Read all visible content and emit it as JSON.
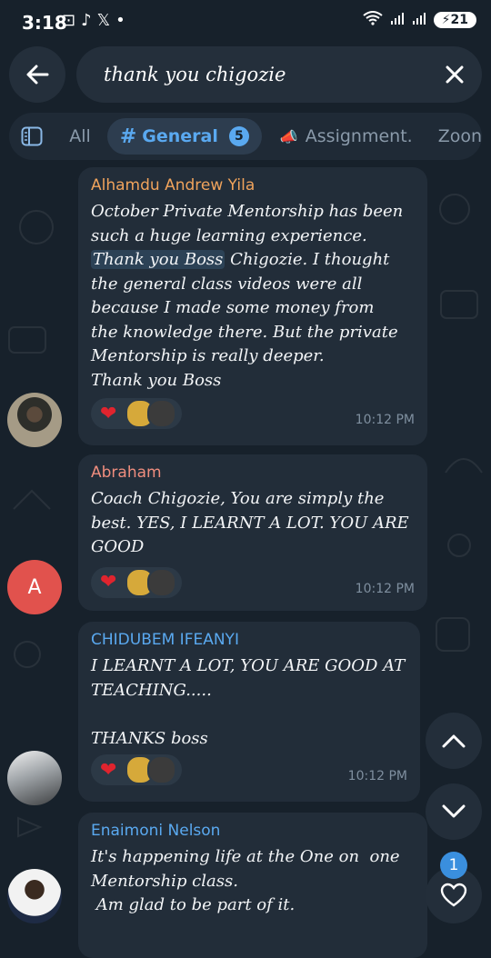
{
  "status_bar": {
    "time": "3:18",
    "battery": "21"
  },
  "search": {
    "query": "thank you chigozie"
  },
  "filters": {
    "tabs": [
      {
        "label": "All"
      },
      {
        "label": "General",
        "badge": "5"
      },
      {
        "label": "Assignment."
      },
      {
        "label": "Zoon"
      }
    ]
  },
  "messages": [
    {
      "sender": "Alhamdu Andrew Yila",
      "sender_color": "#f0a35c",
      "text_before": "October Private Mentorship has been\nsuch a huge learning experience.\n",
      "highlight": "Thank you Boss",
      "text_after": " Chigozie. I thought\nthe general class videos were all\nbecause I made some money from\nthe knowledge there. But the private\nMentorship is really deeper.\nThank you Boss",
      "time": "10:12 PM"
    },
    {
      "sender": "Abraham",
      "sender_color": "#ef8d7e",
      "avatar_letter": "A",
      "text": "Coach Chigozie, You are simply the\nbest. YES, I LEARNT A LOT. YOU ARE\nGOOD",
      "time": "10:12 PM"
    },
    {
      "sender": "CHIDUBEM IFEANYI",
      "sender_color": "#5aa9f0",
      "text": "I LEARNT A LOT, YOU ARE GOOD AT\nTEACHING.....\n\nTHANKS boss",
      "time": "10:12 PM"
    },
    {
      "sender": "Enaimoni Nelson",
      "sender_color": "#5aa9f0",
      "text": "It's happening life at the One on  one\nMentorship class.\n Am glad to be part of it."
    }
  ],
  "fab": {
    "unread_reactions": "1"
  }
}
